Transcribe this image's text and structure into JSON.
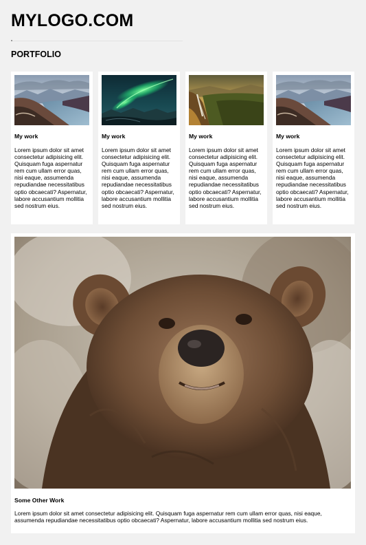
{
  "site": {
    "logo_text": "MYLOGO.COM"
  },
  "portfolio": {
    "heading": "PORTFOLIO",
    "cards": [
      {
        "image": "mountain-lake-landscape",
        "title": "My work",
        "text": "Lorem ipsum dolor sit amet consectetur adipisicing elit. Quisquam fuga aspernatur rem cum ullam error quas, nisi eaque, assumenda repudiandae necessitatibus optio obcaecati? Aspernatur, labore accusantium mollitia sed nostrum eius."
      },
      {
        "image": "northern-lights",
        "title": "My work",
        "text": "Lorem ipsum dolor sit amet consectetur adipisicing elit. Quisquam fuga aspernatur rem cum ullam error quas, nisi eaque, assumenda repudiandae necessitatibus optio obcaecati? Aspernatur, labore accusantium mollitia sed nostrum eius."
      },
      {
        "image": "waterfall-valley",
        "title": "My work",
        "text": "Lorem ipsum dolor sit amet consectetur adipisicing elit. Quisquam fuga aspernatur rem cum ullam error quas, nisi eaque, assumenda repudiandae necessitatibus optio obcaecati? Aspernatur, labore accusantium mollitia sed nostrum eius."
      },
      {
        "image": "mountain-lake-landscape",
        "title": "My work",
        "text": "Lorem ipsum dolor sit amet consectetur adipisicing elit. Quisquam fuga aspernatur rem cum ullam error quas, nisi eaque, assumenda repudiandae necessitatibus optio obcaecati? Aspernatur, labore accusantium mollitia sed nostrum eius."
      }
    ]
  },
  "feature": {
    "image": "brown-bear-portrait",
    "title": "Some Other Work",
    "text": "Lorem ipsum dolor sit amet consectetur adipisicing elit. Quisquam fuga aspernatur rem cum ullam error quas, nisi eaque, assumenda repudiandae necessitatibus optio obcaecati? Aspernatur, labore accusantium mollitia sed nostrum eius."
  }
}
